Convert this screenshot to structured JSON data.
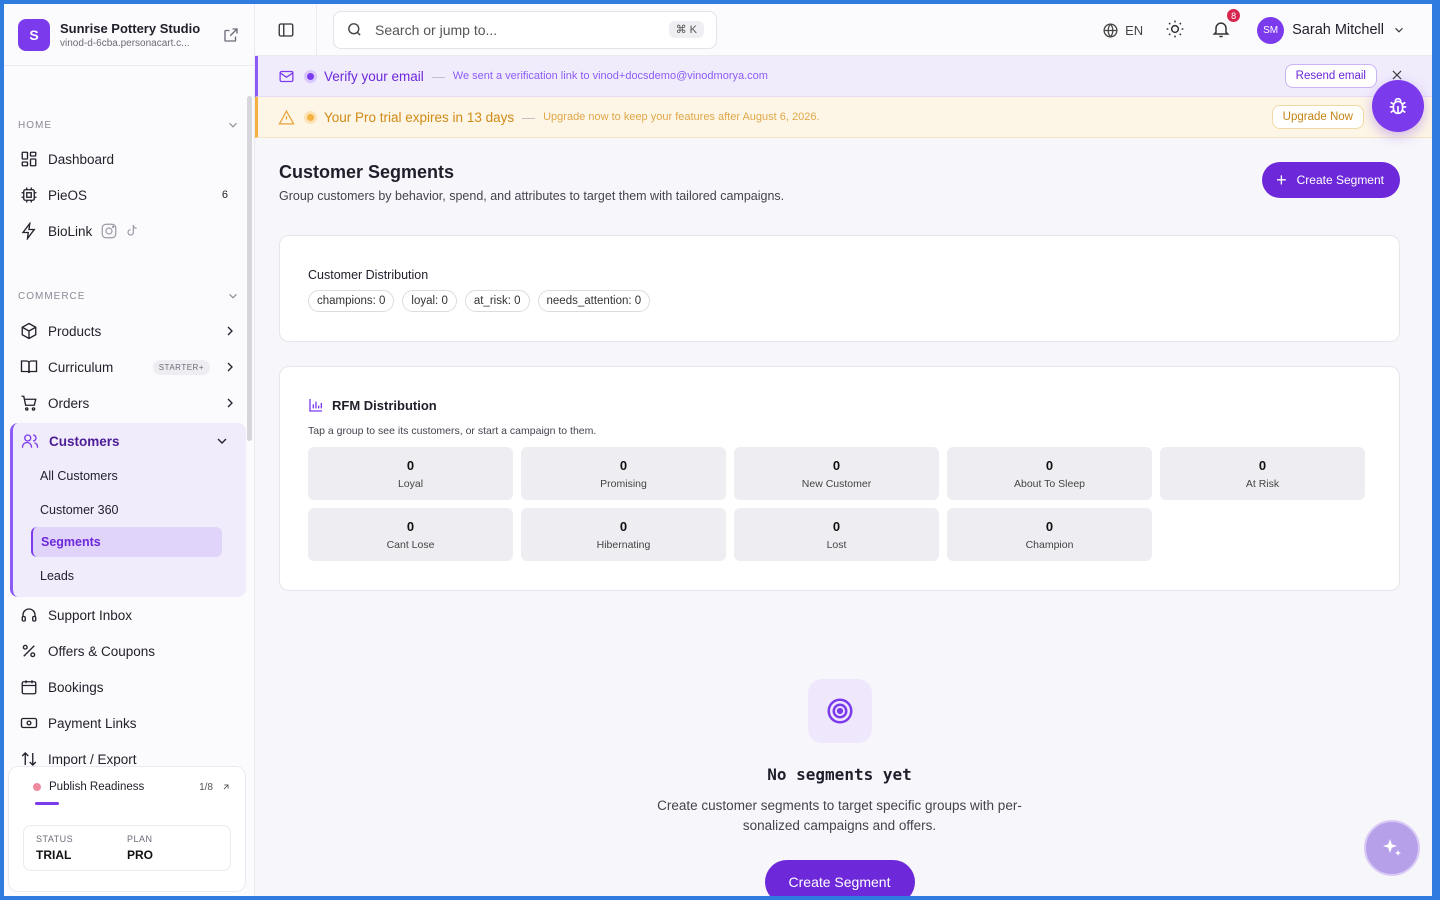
{
  "brand": {
    "initial": "S",
    "name": "Sunrise Pottery Studio",
    "url": "vinod-d-6cba.personacart.c..."
  },
  "sidebar": {
    "home_label": "HOME",
    "home_items": [
      {
        "label": "Dashboard",
        "icon": "dashboard-icon"
      },
      {
        "label": "PieOS",
        "icon": "chip-icon",
        "count": "6"
      },
      {
        "label": "BioLink",
        "icon": "bolt-icon"
      }
    ],
    "commerce_label": "COMMERCE",
    "commerce_items": [
      {
        "label": "Products",
        "icon": "box-icon"
      },
      {
        "label": "Curriculum",
        "icon": "book-icon",
        "badge": "STARTER+"
      },
      {
        "label": "Orders",
        "icon": "cart-icon"
      }
    ],
    "customers": {
      "label": "Customers",
      "sub": [
        "All Customers",
        "Customer 360",
        "Segments",
        "Leads"
      ]
    },
    "more_items": [
      {
        "label": "Support Inbox",
        "icon": "headset-icon"
      },
      {
        "label": "Offers & Coupons",
        "icon": "percent-icon"
      },
      {
        "label": "Bookings",
        "icon": "calendar-icon"
      },
      {
        "label": "Payment Links",
        "icon": "payment-icon"
      },
      {
        "label": "Import / Export",
        "icon": "import-export-icon"
      }
    ],
    "publish": {
      "title": "Publish Readiness",
      "count": "1/8",
      "status_key": "STATUS",
      "status_value": "TRIAL",
      "plan_key": "PLAN",
      "plan_value": "PRO"
    }
  },
  "topbar": {
    "search_placeholder": "Search or jump to...",
    "shortcut": "⌘ K",
    "language": "EN",
    "notifications": "8",
    "user_initials": "SM",
    "user_name": "Sarah Mitchell"
  },
  "banners": {
    "email": {
      "title": "Verify your email",
      "text": "We sent a verification link to vinod+docsdemo@vinodmorya.com",
      "button": "Resend email"
    },
    "trial": {
      "title": "Your Pro trial expires in 13 days",
      "text": "Upgrade now to keep your features after August 6, 2026.",
      "button": "Upgrade Now"
    },
    "separator": "—"
  },
  "page": {
    "title": "Customer Segments",
    "subtitle": "Group customers by behavior, spend, and attributes to target them with tailored campaigns.",
    "create_button": "Create Segment"
  },
  "distribution": {
    "title": "Customer Distribution",
    "chips": [
      "champions: 0",
      "loyal: 0",
      "at_risk: 0",
      "needs_attention: 0"
    ]
  },
  "rfm": {
    "title": "RFM Distribution",
    "subtitle": "Tap a group to see its customers, or start a campaign to them.",
    "tiles": [
      {
        "value": "0",
        "label": "Loyal"
      },
      {
        "value": "0",
        "label": "Promising"
      },
      {
        "value": "0",
        "label": "New Customer"
      },
      {
        "value": "0",
        "label": "About To Sleep"
      },
      {
        "value": "0",
        "label": "At Risk"
      },
      {
        "value": "0",
        "label": "Cant Lose"
      },
      {
        "value": "0",
        "label": "Hibernating"
      },
      {
        "value": "0",
        "label": "Lost"
      },
      {
        "value": "0",
        "label": "Champion"
      }
    ]
  },
  "empty": {
    "title": "No segments yet",
    "text": "Create customer segments to target specific groups with per-sonalized campaigns and offers.",
    "button": "Create Segment"
  },
  "colors": {
    "accent": "#6d28d9",
    "email_banner": "#f1ecfc",
    "trial_banner": "#fdf6e6",
    "notif_badge": "#d6264f"
  }
}
